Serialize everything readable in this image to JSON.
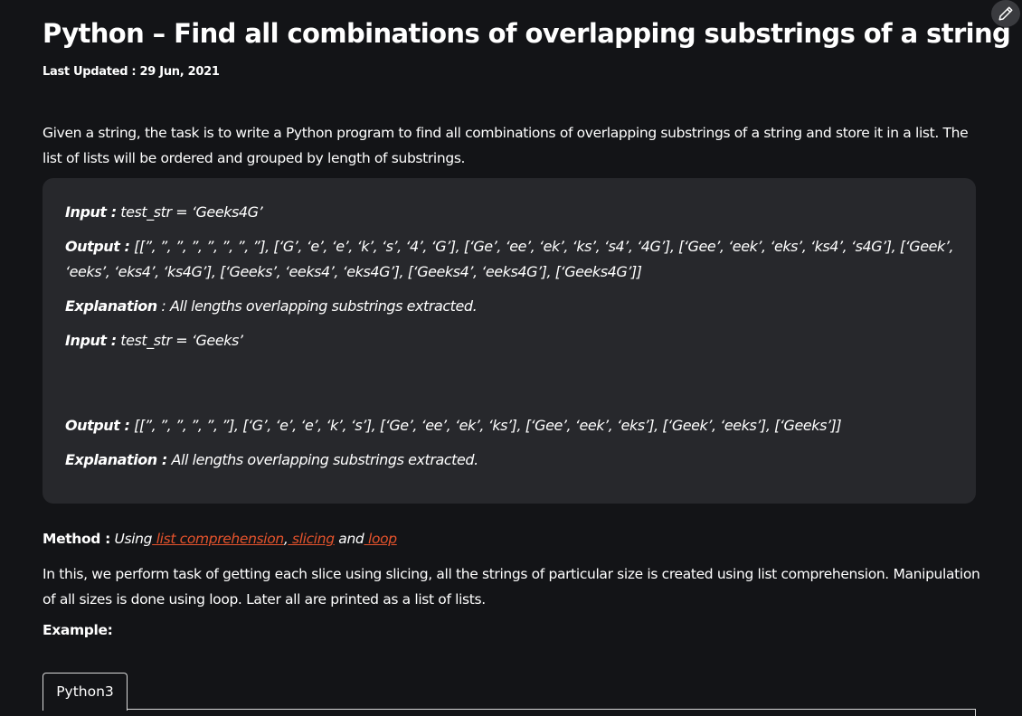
{
  "article": {
    "title": "Python – Find all combinations of overlapping substrings of a string",
    "last_updated": "Last Updated : 29 Jun, 2021",
    "intro": "Given a string, the task is to write a Python program to find all combinations of overlapping substrings of a string and store it in a list. The list of lists will be ordered and grouped by length of substrings.",
    "examples": {
      "input1_label": "Input :",
      "input1_value": " test_str = ‘Geeks4G’",
      "output1_label": "Output :",
      "output1_value": " [[”, ”, ”, ”, ”, ”, ”, ”], [‘G’, ‘e’, ‘e’, ‘k’, ‘s’, ‘4’, ‘G’], [‘Ge’, ‘ee’, ‘ek’, ‘ks’, ‘s4’, ‘4G’], [‘Gee’, ‘eek’, ‘eks’, ‘ks4’, ‘s4G’], [‘Geek’, ‘eeks’, ‘eks4’, ‘ks4G’], [‘Geeks’, ‘eeks4’, ‘eks4G’], [‘Geeks4’, ‘eeks4G’], [‘Geeks4G’]]",
      "explanation1_label": "Explanation",
      "explanation1_value": " : All lengths overlapping substrings extracted.",
      "input2_label": "Input :",
      "input2_value": " test_str = ‘Geeks’",
      "output2_label": "Output :",
      "output2_value": " [[”, ”, ”, ”, ”, ”], [‘G’, ‘e’, ‘e’, ‘k’, ‘s’], [‘Ge’, ‘ee’, ‘ek’, ‘ks’], [‘Gee’, ‘eek’, ‘eks’], [‘Geek’, ‘eeks’], [‘Geeks’]]",
      "explanation2_label": "Explanation :",
      "explanation2_value": " All lengths overlapping substrings extracted."
    },
    "method": {
      "label": "Method :",
      "prefix": " Using",
      "link1": " list comprehension",
      "sep1": ",",
      "link2": " slicing",
      "sep2": " and",
      "link3": " loop"
    },
    "method_description": "In this, we perform task of getting each slice using slicing, all the strings of particular size is created using list comprehension. Manipulation of all sizes is done using loop. Later all are printed as a list of lists.",
    "example_heading": "Example:",
    "code_tab": "Python3"
  },
  "colors": {
    "background": "#131417",
    "card": "#27282c",
    "link": "#e5532c"
  },
  "icons": {
    "edit": "pencil-icon"
  }
}
